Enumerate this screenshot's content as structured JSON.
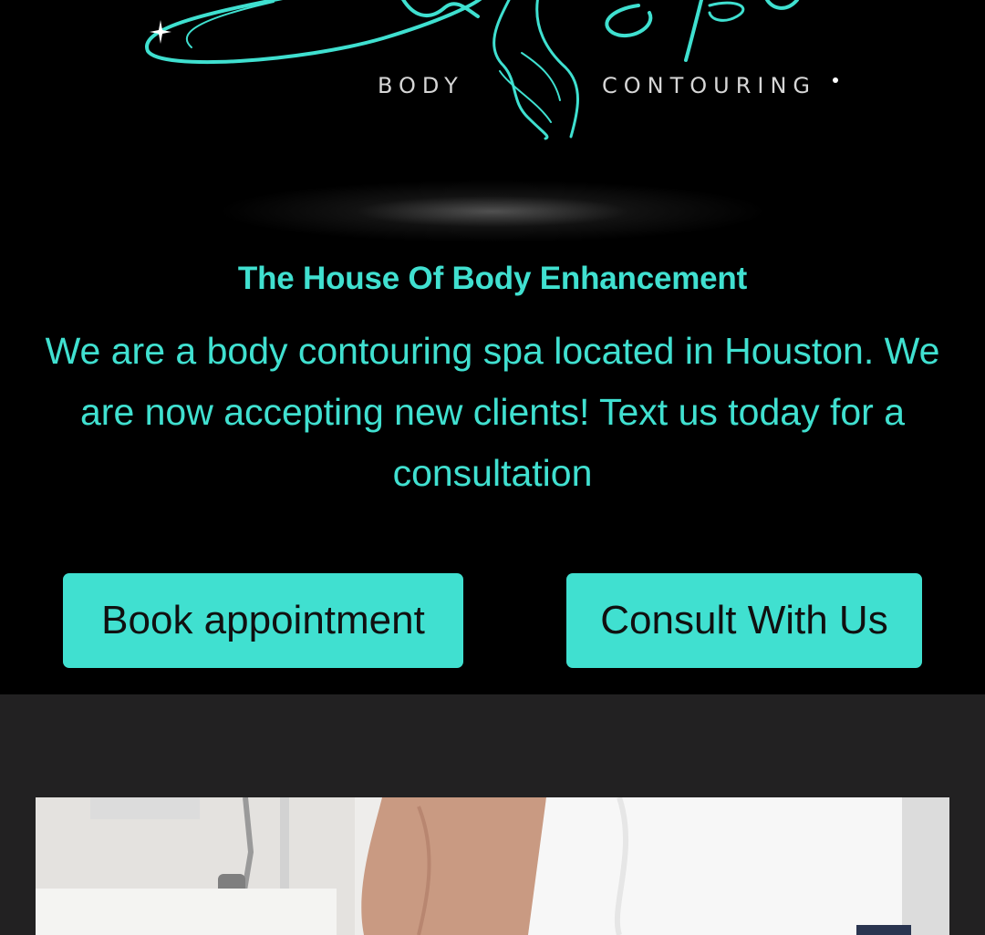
{
  "logo": {
    "name": "Spa",
    "word_left": "BODY",
    "word_right": "CONTOURING"
  },
  "hero": {
    "tagline": "The House Of Body Enhancement",
    "intro": {
      "line1": "We are a body contouring spa located in Houston. We",
      "line2": "are now accepting new clients! Text us today for a",
      "line3": "consultation"
    }
  },
  "buttons": {
    "book_label": "Book appointment",
    "consult_label": "Consult With Us"
  },
  "photo": {
    "icon": "spa-treatment-photo"
  },
  "colors": {
    "accent": "#40e0d0",
    "background": "#000000",
    "section_background": "#222122",
    "button_text": "#101010"
  }
}
